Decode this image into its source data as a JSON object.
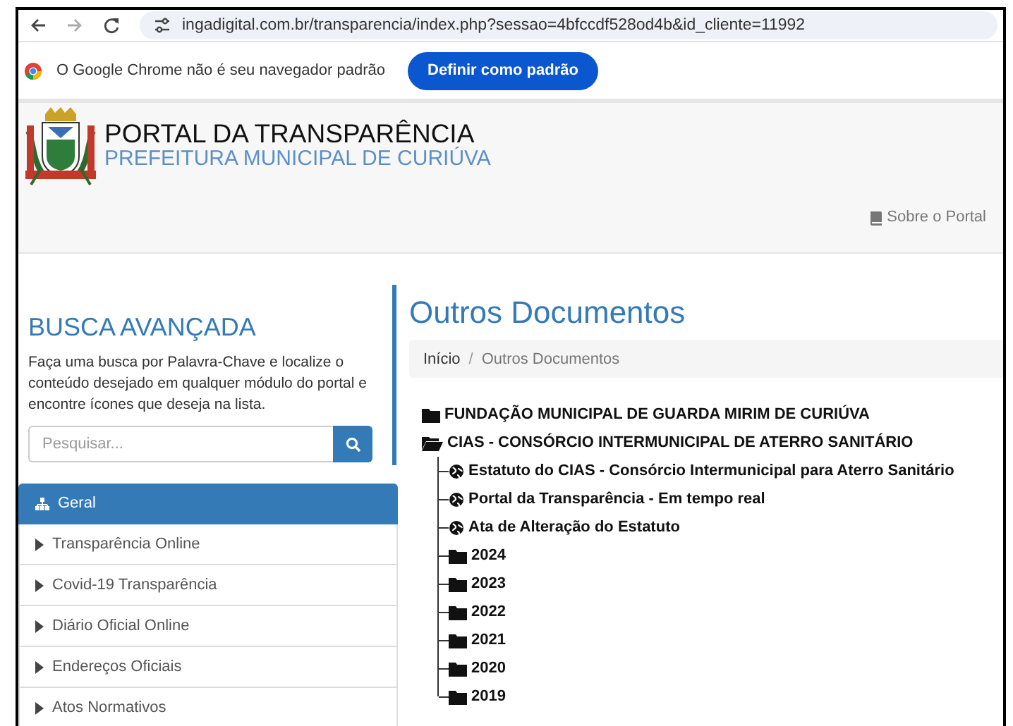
{
  "browser": {
    "url": "ingadigital.com.br/transparencia/index.php?sessao=4bfccdf528od4b&id_cliente=11992",
    "infobar_text": "O Google Chrome não é seu navegador padrão",
    "infobar_button": "Definir como padrão"
  },
  "header": {
    "title": "PORTAL DA TRANSPARÊNCIA",
    "subtitle": "PREFEITURA MUNICIPAL DE CURIÚVA",
    "about_link": "Sobre o Portal"
  },
  "search_panel": {
    "title": "BUSCA AVANÇADA",
    "description": "Faça uma busca por Palavra-Chave e localize o conteúdo desejado em qualquer módulo do portal e encontre ícones que deseja na lista.",
    "placeholder": "Pesquisar..."
  },
  "sidebar": {
    "items": [
      {
        "label": "Geral",
        "selected": true
      },
      {
        "label": "Transparência Online",
        "selected": false
      },
      {
        "label": "Covid-19 Transparência",
        "selected": false
      },
      {
        "label": "Diário Oficial Online",
        "selected": false
      },
      {
        "label": "Endereços Oficiais",
        "selected": false
      },
      {
        "label": "Atos Normativos",
        "selected": false
      }
    ]
  },
  "page_title": "Outros Documentos",
  "breadcrumb": [
    "Início",
    "Outros Documentos"
  ],
  "breadcrumb_separator": "/",
  "tree": [
    {
      "kind": "folder",
      "label": "FUNDAÇÃO MUNICIPAL DE GUARDA MIRIM DE CURIÚVA",
      "expanded": false
    },
    {
      "kind": "folder",
      "label": "CIAS - CONSÓRCIO INTERMUNICIPAL DE ATERRO SANITÁRIO",
      "expanded": true,
      "children": [
        {
          "kind": "document",
          "label": "Estatuto do CIAS - Consórcio Intermunicipal para Aterro Sanitário"
        },
        {
          "kind": "document",
          "label": "Portal da Transparência - Em tempo real"
        },
        {
          "kind": "document",
          "label": "Ata de Alteração do Estatuto"
        },
        {
          "kind": "folder",
          "label": "2024",
          "expanded": false
        },
        {
          "kind": "folder",
          "label": "2023",
          "expanded": false
        },
        {
          "kind": "folder",
          "label": "2022",
          "expanded": false
        },
        {
          "kind": "folder",
          "label": "2021",
          "expanded": false
        },
        {
          "kind": "folder",
          "label": "2020",
          "expanded": false
        },
        {
          "kind": "folder",
          "label": "2019",
          "expanded": false
        }
      ]
    }
  ]
}
